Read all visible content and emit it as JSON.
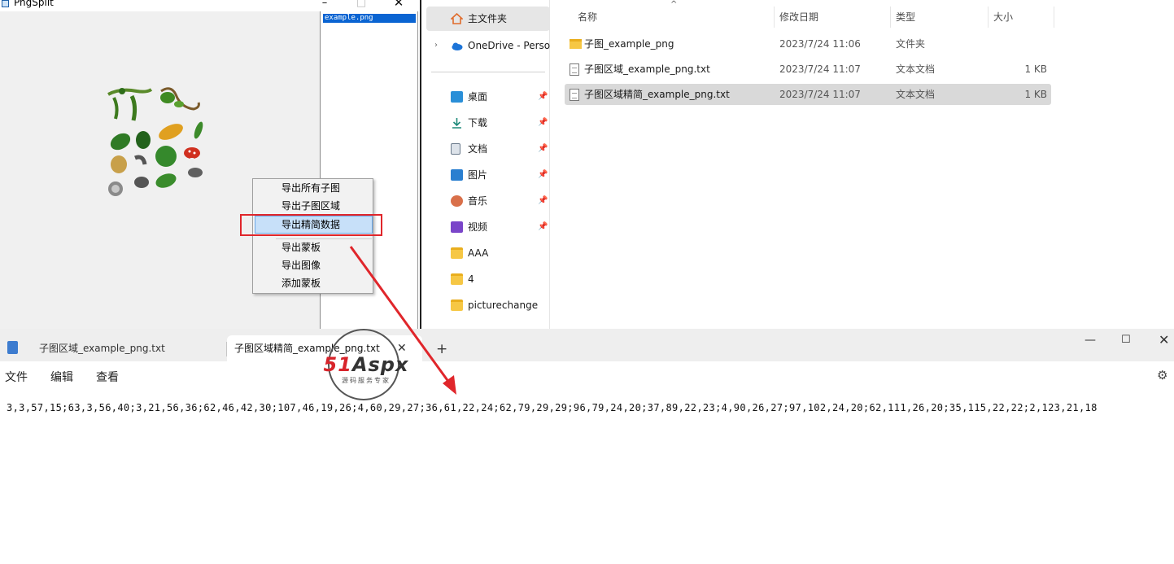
{
  "pngsplit": {
    "title": "PngSplit",
    "controls": {
      "minimize": "–",
      "maximize": "□",
      "close": "✕"
    },
    "list_items": [
      "example.png"
    ],
    "context_menu": {
      "items": [
        "导出所有子图",
        "导出子图区域",
        "导出精简数据",
        "导出蒙板",
        "导出图像",
        "添加蒙板"
      ],
      "highlighted": "导出精简数据"
    }
  },
  "explorer": {
    "nav": {
      "home": "主文件夹",
      "onedrive": "OneDrive - Perso",
      "pinned": [
        "桌面",
        "下载",
        "文档",
        "图片",
        "音乐",
        "视频"
      ],
      "folders": [
        "AAA",
        "4",
        "picturechange"
      ]
    },
    "columns": {
      "name": "名称",
      "date": "修改日期",
      "type": "类型",
      "size": "大小"
    },
    "files": [
      {
        "name": "子图_example_png",
        "date": "2023/7/24 11:06",
        "type": "文件夹",
        "size": ""
      },
      {
        "name": "子图区域_example_png.txt",
        "date": "2023/7/24 11:07",
        "type": "文本文档",
        "size": "1 KB"
      },
      {
        "name": "子图区域精简_example_png.txt",
        "date": "2023/7/24 11:07",
        "type": "文本文档",
        "size": "1 KB"
      }
    ],
    "selected_file": "子图区域精简_example_png.txt"
  },
  "notepad": {
    "tabs": [
      "子图区域_example_png.txt",
      "子图区域精简_example_png.txt"
    ],
    "active_tab": "子图区域精简_example_png.txt",
    "new_tab": "+",
    "tab_close": "✕",
    "controls": {
      "minimize": "—",
      "maximize": "☐",
      "close": "✕"
    },
    "menus": [
      "文件",
      "编辑",
      "查看"
    ],
    "settings_icon": "gear-icon",
    "content": "3,3,57,15;63,3,56,40;3,21,56,36;62,46,42,30;107,46,19,26;4,60,29,27;36,61,22,24;62,79,29,29;96,79,24,20;37,89,22,23;4,90,26,27;97,102,24,20;62,111,26,20;35,115,22,22;2,123,21,18"
  },
  "watermark": {
    "logo_red": "51",
    "logo_dark": "Aspx",
    "subtitle": "源码服务专家"
  },
  "colors": {
    "highlight": "#c7e0f9",
    "annotation_red": "#e0262b",
    "selection_blue": "#0a64d2"
  }
}
